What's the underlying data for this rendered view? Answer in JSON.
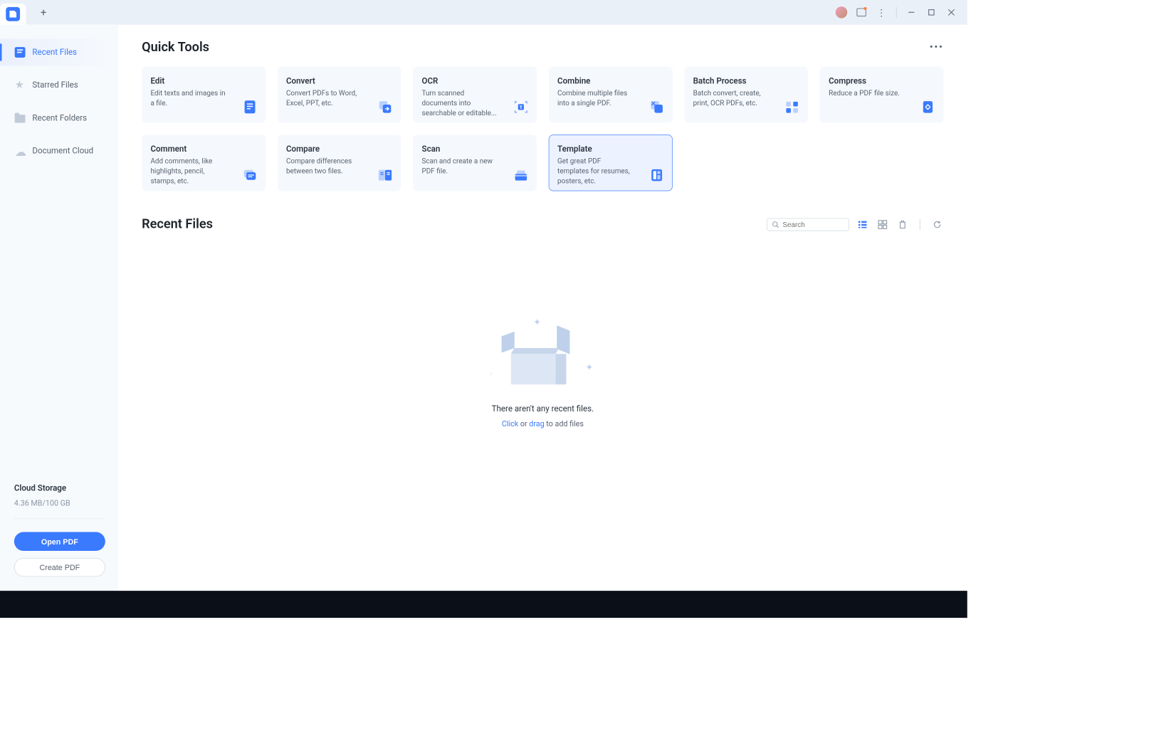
{
  "sidebar": {
    "items": [
      {
        "label": "Recent Files"
      },
      {
        "label": "Starred Files"
      },
      {
        "label": "Recent Folders"
      },
      {
        "label": "Document Cloud"
      }
    ],
    "cloud": {
      "title": "Cloud Storage",
      "usage": "4.36 MB/100 GB"
    },
    "open_btn": "Open PDF",
    "create_btn": "Create PDF"
  },
  "quick_tools": {
    "title": "Quick Tools",
    "items": [
      {
        "title": "Edit",
        "desc": "Edit texts and images in a file."
      },
      {
        "title": "Convert",
        "desc": "Convert PDFs to Word, Excel, PPT, etc."
      },
      {
        "title": "OCR",
        "desc": "Turn scanned documents into searchable or editable..."
      },
      {
        "title": "Combine",
        "desc": "Combine multiple files into a single PDF."
      },
      {
        "title": "Batch Process",
        "desc": "Batch convert, create, print, OCR PDFs, etc."
      },
      {
        "title": "Compress",
        "desc": "Reduce a PDF file size."
      },
      {
        "title": "Comment",
        "desc": "Add comments, like highlights, pencil, stamps, etc."
      },
      {
        "title": "Compare",
        "desc": "Compare differences between two files."
      },
      {
        "title": "Scan",
        "desc": "Scan and create a new PDF file."
      },
      {
        "title": "Template",
        "desc": "Get great PDF templates for resumes, posters, etc."
      }
    ]
  },
  "recent_files": {
    "title": "Recent Files",
    "search_placeholder": "Search",
    "empty_text": "There aren't any recent files.",
    "empty_click": "Click",
    "empty_or": " or ",
    "empty_drag": "drag",
    "empty_tail": " to add files"
  }
}
